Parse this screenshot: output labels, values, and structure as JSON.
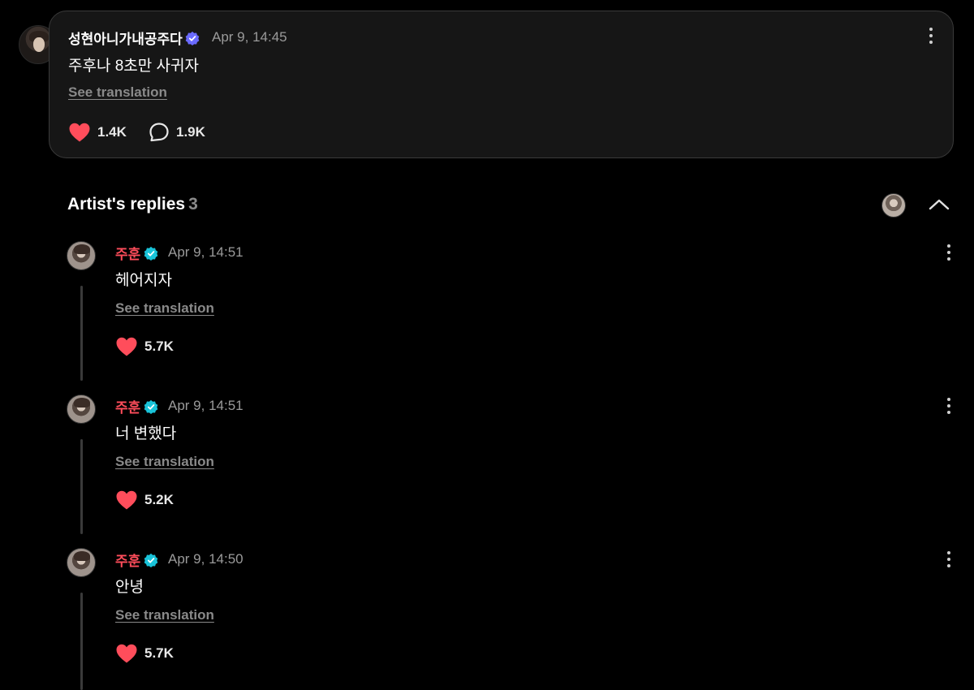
{
  "post": {
    "author": "성현아니가내공주다",
    "time": "Apr 9, 14:45",
    "body": "주후나 8초만 사귀자",
    "see_translation": "See translation",
    "likes": "1.4K",
    "comments": "1.9K"
  },
  "artist_replies": {
    "title": "Artist's replies",
    "count": "3",
    "items": [
      {
        "name": "주훈",
        "time": "Apr 9, 14:51",
        "text": "헤어지자",
        "see_translation": "See translation",
        "likes": "5.7K"
      },
      {
        "name": "주훈",
        "time": "Apr 9, 14:51",
        "text": "너 변했다",
        "see_translation": "See translation",
        "likes": "5.2K"
      },
      {
        "name": "주훈",
        "time": "Apr 9, 14:50",
        "text": "안녕",
        "see_translation": "See translation",
        "likes": "5.7K"
      }
    ]
  },
  "colors": {
    "background": "#000000",
    "card": "#161616",
    "artist_name": "#ff4d5b",
    "heart": "#ff4d5b",
    "verified_post": "#6b6bff",
    "verified_artist": "#19c3d9",
    "muted": "#9a9a9a"
  },
  "icons": {
    "post_like": "heart-icon",
    "post_comment": "speech-bubble-icon",
    "menu": "kebab-menu-icon",
    "collapse": "chevron-up-icon",
    "verified": "verified-badge-icon"
  }
}
